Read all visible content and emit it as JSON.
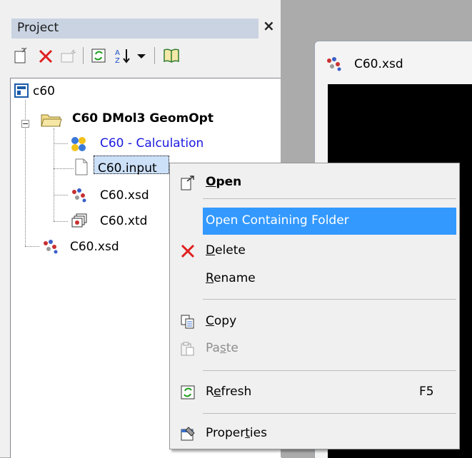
{
  "panel": {
    "title": "Project",
    "close_glyph": "×"
  },
  "toolbar": {
    "buttons": [
      "new-icon",
      "delete-icon",
      "new-disabled-icon",
      "refresh-icon",
      "sort-icon",
      "dropdown-icon",
      "book-icon"
    ]
  },
  "tree": {
    "root": "c60",
    "folder": "C60 DMol3 GeomOpt",
    "calc": "C60 - Calculation",
    "input": "C60.input",
    "xsd1": "C60.xsd",
    "xtd": "C60.xtd",
    "xsd2": "C60.xsd"
  },
  "document": {
    "title": "C60.xsd"
  },
  "menu": {
    "open_u": "O",
    "open_r": "pen",
    "open_folder": "Open Containing Folder",
    "delete_u": "D",
    "delete_r": "elete",
    "rename_u": "R",
    "rename_r": "ename",
    "copy_u": "C",
    "copy_r": "opy",
    "paste_a": "Pa",
    "paste_u": "s",
    "paste_r": "te",
    "refresh_a": "R",
    "refresh_u": "e",
    "refresh_r": "fresh",
    "refresh_shortcut": "F5",
    "props_a": "Proper",
    "props_u": "t",
    "props_r": "ies"
  },
  "colors": {
    "highlight": "#3399ff",
    "title_bar": "#c9d3e2",
    "calc_text": "#1a1ae0"
  }
}
